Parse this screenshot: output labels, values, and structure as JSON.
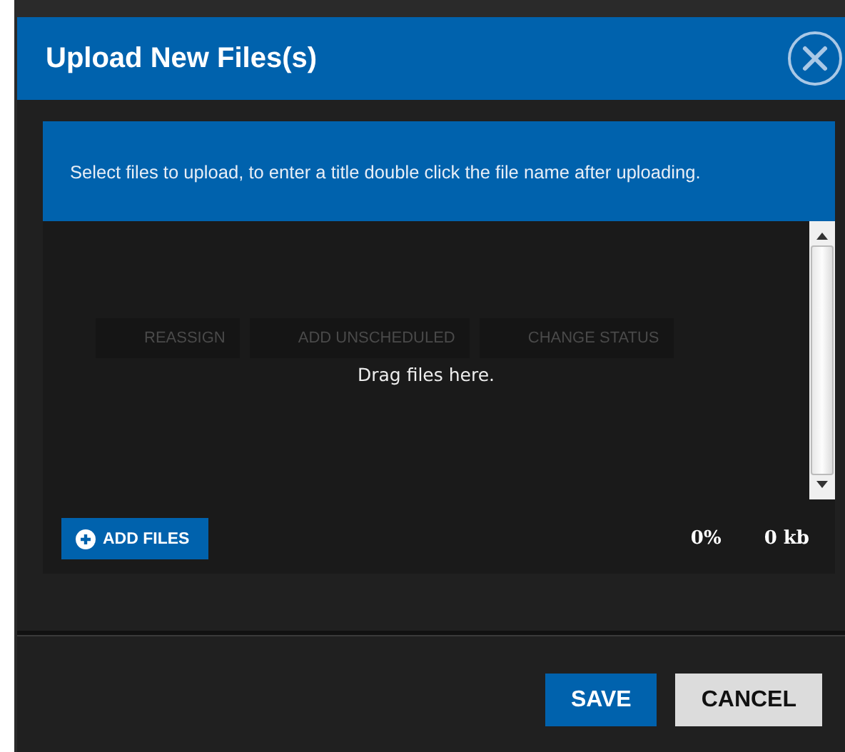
{
  "dialog": {
    "title": "Upload New Files(s)",
    "message": "Select files to upload, to enter a title double click the file name after uploading.",
    "background_toolbar": [
      "REASSIGN",
      "ADD UNSCHEDULED",
      "CHANGE STATUS"
    ],
    "drop_zone": {
      "hint": "Drag files here."
    },
    "add_files": "ADD FILES",
    "percent": "0%",
    "size": "0 kb",
    "buttons": [
      {
        "label": "SAVE",
        "kind": "primary"
      },
      {
        "label": "CANCEL",
        "kind": "secondary"
      }
    ]
  }
}
